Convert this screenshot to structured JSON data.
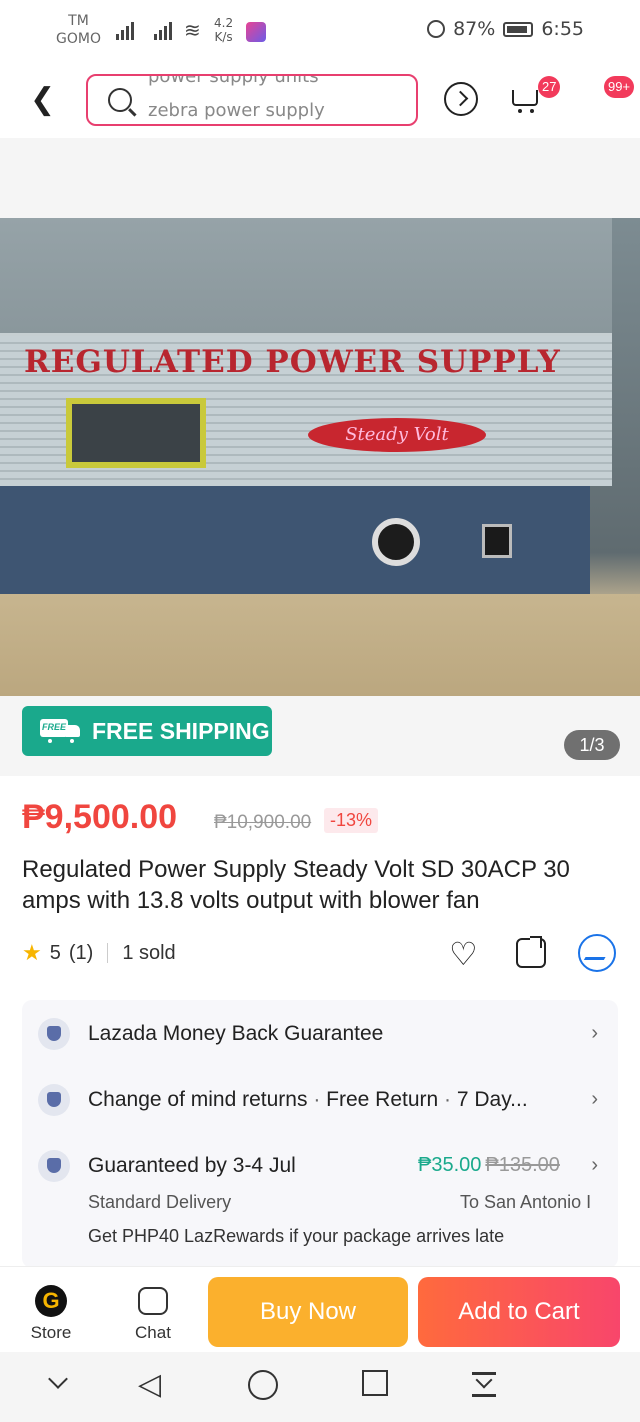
{
  "status_bar": {
    "carrier_line1": "TM",
    "carrier_line2": "GOMO",
    "speed_value": "4.2",
    "speed_unit": "K/s",
    "battery": "87%",
    "time": "6:55"
  },
  "header": {
    "search_line1": "power supply units",
    "search_line2": "zebra power supply",
    "cart_badge": "27",
    "more_badge": "99+"
  },
  "gallery": {
    "photo_label": "REGULATED POWER SUPPLY",
    "photo_brand": "Steady Volt",
    "free_shipping": "FREE SHIPPING",
    "free_tag": "FREE",
    "pager": "1/3"
  },
  "product": {
    "price": "₱9,500.00",
    "original_price": "₱10,900.00",
    "discount": "-13%",
    "title": "Regulated Power Supply Steady Volt SD 30ACP 30 amps with 13.8 volts output with blower fan",
    "rating": "5",
    "rating_count": "(1)",
    "sold": "1 sold"
  },
  "services": {
    "guarantee": "Lazada Money Back Guarantee",
    "returns_a": "Change of mind returns",
    "returns_b": "Free Return",
    "returns_c": "7 Day...",
    "delivery": "Guaranteed by 3-4 Jul",
    "ship_price": "₱35.00",
    "ship_old_price": "₱135.00",
    "delivery_type": "Standard Delivery",
    "destination": "To San Antonio I",
    "lazrewards": "Get PHP40 LazRewards if your package arrives late"
  },
  "bottom_bar": {
    "store_label": "Store",
    "chat_label": "Chat",
    "buy_now": "Buy Now",
    "add_to_cart": "Add to Cart"
  }
}
